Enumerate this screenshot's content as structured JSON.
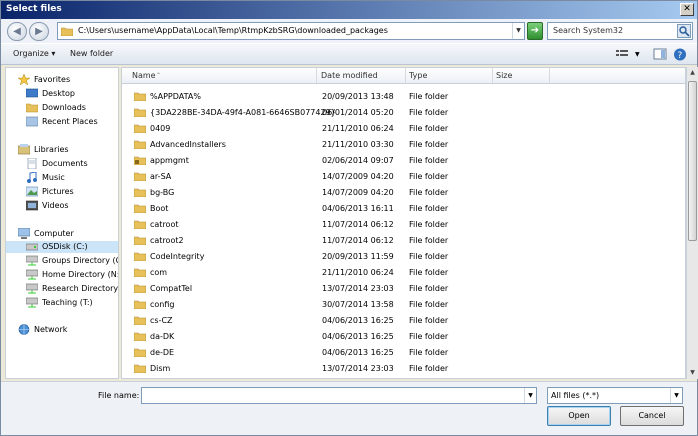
{
  "window": {
    "title": "Select files",
    "close_label": "✕"
  },
  "address": {
    "path": "C:\\Users\\username\\AppData\\Local\\Temp\\RtmpKzbSRG\\downloaded_packages",
    "search_placeholder": "Search System32"
  },
  "toolbar": {
    "organize_label": "Organize",
    "new_folder_label": "New folder"
  },
  "sidebar": {
    "favorites": {
      "label": "Favorites",
      "items": [
        "Desktop",
        "Downloads",
        "Recent Places"
      ]
    },
    "libraries": {
      "label": "Libraries",
      "items": [
        "Documents",
        "Music",
        "Pictures",
        "Videos"
      ]
    },
    "computer": {
      "label": "Computer",
      "items": [
        "OSDisk (C:)",
        "Groups Directory (G:)",
        "Home Directory (N:)",
        "Research Directory (R",
        "Teaching (T:)"
      ]
    },
    "network": {
      "label": "Network"
    }
  },
  "columns": {
    "name": "Name",
    "date": "Date modified",
    "type": "Type",
    "size": "Size"
  },
  "files": [
    {
      "name": "%APPDATA%",
      "date": "20/09/2013 13:48",
      "type": "File folder"
    },
    {
      "name": "{3DA228BE-34DA-49f4-A081-6646SB077429}",
      "date": "06/01/2014 05:20",
      "type": "File folder"
    },
    {
      "name": "0409",
      "date": "21/11/2010 06:24",
      "type": "File folder"
    },
    {
      "name": "AdvancedInstallers",
      "date": "21/11/2010 03:30",
      "type": "File folder"
    },
    {
      "name": "appmgmt",
      "date": "02/06/2014 09:07",
      "type": "File folder"
    },
    {
      "name": "ar-SA",
      "date": "14/07/2009 04:20",
      "type": "File folder"
    },
    {
      "name": "bg-BG",
      "date": "14/07/2009 04:20",
      "type": "File folder"
    },
    {
      "name": "Boot",
      "date": "04/06/2013 16:11",
      "type": "File folder"
    },
    {
      "name": "catroot",
      "date": "11/07/2014 06:12",
      "type": "File folder"
    },
    {
      "name": "catroot2",
      "date": "11/07/2014 06:12",
      "type": "File folder"
    },
    {
      "name": "CodeIntegrity",
      "date": "20/09/2013 11:59",
      "type": "File folder"
    },
    {
      "name": "com",
      "date": "21/11/2010 06:24",
      "type": "File folder"
    },
    {
      "name": "CompatTel",
      "date": "13/07/2014 23:03",
      "type": "File folder"
    },
    {
      "name": "config",
      "date": "30/07/2014 13:58",
      "type": "File folder"
    },
    {
      "name": "cs-CZ",
      "date": "04/06/2013 16:25",
      "type": "File folder"
    },
    {
      "name": "da-DK",
      "date": "04/06/2013 16:25",
      "type": "File folder"
    },
    {
      "name": "de-DE",
      "date": "04/06/2013 16:25",
      "type": "File folder"
    },
    {
      "name": "Dism",
      "date": "13/07/2014 23:03",
      "type": "File folder"
    }
  ],
  "bottom": {
    "filename_label": "File name:",
    "filename_value": "",
    "filter_value": "All files (*.*)",
    "open_label": "Open",
    "cancel_label": "Cancel"
  }
}
